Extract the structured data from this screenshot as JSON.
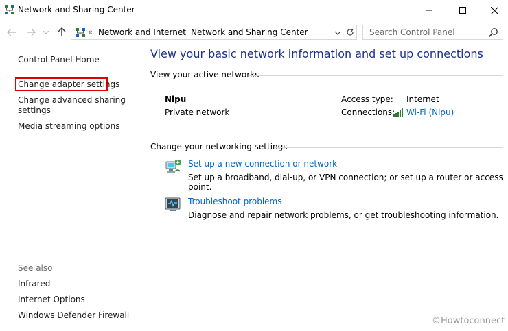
{
  "window": {
    "title": "Network and Sharing Center",
    "minimize_glyph": "—",
    "maximize_glyph": "☐",
    "close_glyph": "✕"
  },
  "nav": {
    "back_glyph": "←",
    "forward_glyph": "→",
    "up_glyph": "↑",
    "overflow": "«",
    "breadcrumbs": [
      "Network and Internet",
      "Network and Sharing Center"
    ],
    "crumb_separator": "›",
    "search_placeholder": "Search Control Panel"
  },
  "sidebar": {
    "home": "Control Panel Home",
    "change_adapter": "Change adapter settings",
    "change_advanced": [
      "Change advanced sharing",
      "settings"
    ],
    "media_streaming": "Media streaming options",
    "see_also_label": "See also",
    "see_also": [
      "Infrared",
      "Internet Options",
      "Windows Defender Firewall"
    ]
  },
  "main": {
    "title": "View your basic network information and set up connections",
    "active_networks_header": "View your active networks",
    "network": {
      "name": "Nipu",
      "type": "Private network",
      "access_type_label": "Access type:",
      "access_type_value": "Internet",
      "connections_label": "Connections:",
      "connections_value": "Wi-Fi (Nipu)"
    },
    "settings_header": "Change your networking settings",
    "tasks": [
      {
        "icon": "new-connection-icon",
        "link": "Set up a new connection or network",
        "desc": "Set up a broadband, dial-up, or VPN connection; or set up a router or access point."
      },
      {
        "icon": "troubleshoot-icon",
        "link": "Troubleshoot problems",
        "desc": "Diagnose and repair network problems, or get troubleshooting information."
      }
    ]
  },
  "watermark": "©Howtoconnect",
  "colors": {
    "link": "#0066cc",
    "title": "#1e3287",
    "highlight_border": "#e00000"
  }
}
